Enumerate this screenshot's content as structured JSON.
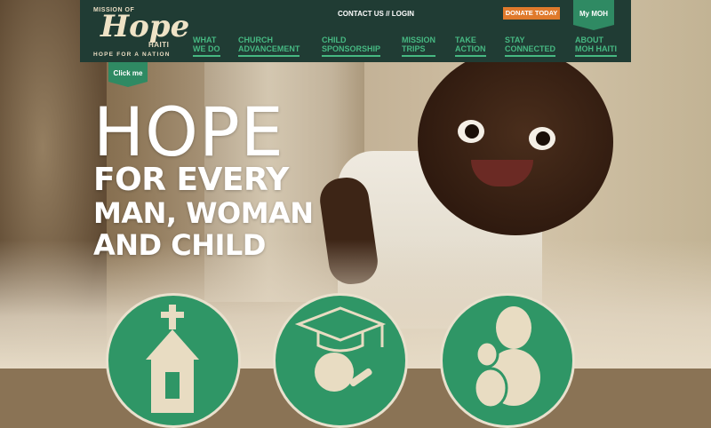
{
  "logo": {
    "mission_of": "MISSION OF",
    "hope": "Hope",
    "haiti": "HAITI",
    "tagline": "HOPE FOR A NATION"
  },
  "header": {
    "contact_login": "CONTACT US // LOGIN",
    "donate_label": "DONATE TODAY",
    "my_moh_label": "My MOH"
  },
  "menu": [
    {
      "line1": "WHAT",
      "line2": "WE DO"
    },
    {
      "line1": "CHURCH",
      "line2": "ADVANCEMENT"
    },
    {
      "line1": "CHILD",
      "line2": "SPONSORSHIP"
    },
    {
      "line1": "MISSION",
      "line2": "TRIPS"
    },
    {
      "line1": "TAKE",
      "line2": "ACTION"
    },
    {
      "line1": "STAY",
      "line2": "CONNECTED"
    },
    {
      "line1": "ABOUT",
      "line2": "MOH HAITI"
    }
  ],
  "click_me": "Click me",
  "hero": {
    "hope": "HOPE",
    "line1": "FOR EVERY",
    "line2": "MAN, WOMAN",
    "line3": "AND CHILD"
  },
  "feature_icons": [
    "church-icon",
    "graduate-icon",
    "people-icon"
  ],
  "colors": {
    "nav_bg": "#203c34",
    "accent_green": "#2f8a63",
    "menu_green": "#46b882",
    "donate_orange": "#e07a2c"
  }
}
